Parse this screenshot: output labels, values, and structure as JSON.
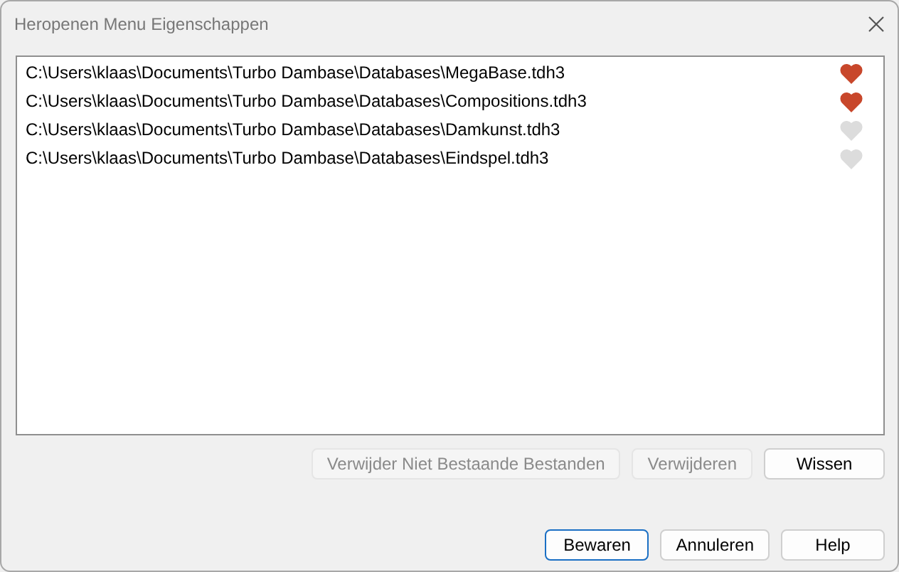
{
  "window": {
    "title": "Heropenen Menu Eigenschappen"
  },
  "files": [
    {
      "path": "C:\\Users\\klaas\\Documents\\Turbo Dambase\\Databases\\MegaBase.tdh3",
      "favorite": true
    },
    {
      "path": "C:\\Users\\klaas\\Documents\\Turbo Dambase\\Databases\\Compositions.tdh3",
      "favorite": true
    },
    {
      "path": "C:\\Users\\klaas\\Documents\\Turbo Dambase\\Databases\\Damkunst.tdh3",
      "favorite": false
    },
    {
      "path": "C:\\Users\\klaas\\Documents\\Turbo Dambase\\Databases\\Eindspel.tdh3",
      "favorite": false
    }
  ],
  "list_buttons": [
    {
      "label": "Verwijder Niet Bestaande Bestanden",
      "disabled": true
    },
    {
      "label": "Verwijderen",
      "disabled": true
    },
    {
      "label": "Wissen",
      "disabled": false
    }
  ],
  "dialog_buttons": [
    {
      "label": "Bewaren",
      "default": true
    },
    {
      "label": "Annuleren",
      "default": false
    },
    {
      "label": "Help",
      "default": false
    }
  ]
}
